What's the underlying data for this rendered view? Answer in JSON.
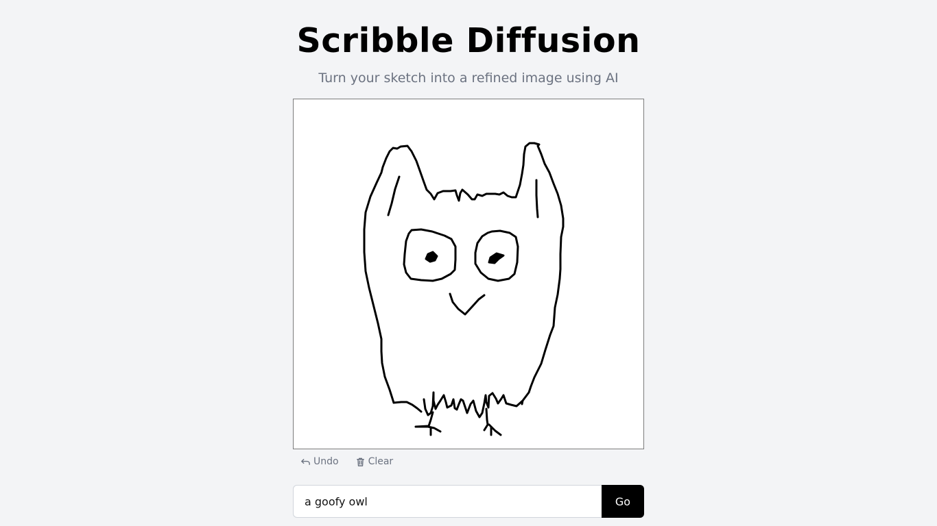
{
  "header": {
    "title": "Scribble Diffusion",
    "subtitle": "Turn your sketch into a refined image using AI"
  },
  "canvas": {
    "sketch_description": "owl scribble",
    "stroke_color": "#000000",
    "background": "#ffffff"
  },
  "tools": {
    "undo_label": "Undo",
    "undo_icon": "undo-arrow-icon",
    "clear_label": "Clear",
    "clear_icon": "trash-icon"
  },
  "prompt": {
    "value": "a goofy owl",
    "placeholder": "",
    "go_label": "Go"
  },
  "colors": {
    "background": "#f3f4f6",
    "subtitle": "#6b7280",
    "button": "#000000"
  }
}
